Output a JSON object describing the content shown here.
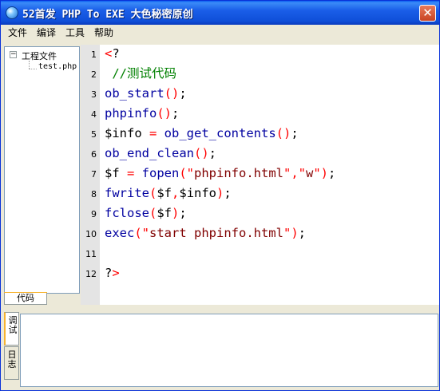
{
  "window": {
    "title": "52首发 PHP To EXE 大色秘密原创",
    "close_symbol": "✕"
  },
  "menu": [
    "文件",
    "编译",
    "工具",
    "帮助"
  ],
  "tree": {
    "expander": "−",
    "root": "工程文件",
    "child": "test.php"
  },
  "tabs": {
    "code": "代码",
    "debug": "调试",
    "log": "日志"
  },
  "line_numbers": [
    "1",
    "2",
    "3",
    "4",
    "5",
    "6",
    "7",
    "8",
    "9",
    "10",
    "11",
    "12"
  ],
  "code": [
    [
      {
        "t": "<",
        "c": "#ff0000"
      },
      {
        "t": "?",
        "c": "#000000"
      }
    ],
    [
      {
        "t": " //测试代码",
        "c": "#008000"
      }
    ],
    [
      {
        "t": "ob_start",
        "c": "#0000a0"
      },
      {
        "t": "()",
        "c": "#ff0000"
      },
      {
        "t": ";",
        "c": "#000000"
      }
    ],
    [
      {
        "t": "phpinfo",
        "c": "#0000a0"
      },
      {
        "t": "()",
        "c": "#ff0000"
      },
      {
        "t": ";",
        "c": "#000000"
      }
    ],
    [
      {
        "t": "$info",
        "c": "#000000"
      },
      {
        "t": " = ",
        "c": "#ff0000"
      },
      {
        "t": "ob_get_contents",
        "c": "#0000a0"
      },
      {
        "t": "()",
        "c": "#ff0000"
      },
      {
        "t": ";",
        "c": "#000000"
      }
    ],
    [
      {
        "t": "ob_end_clean",
        "c": "#0000a0"
      },
      {
        "t": "()",
        "c": "#ff0000"
      },
      {
        "t": ";",
        "c": "#000000"
      }
    ],
    [
      {
        "t": "$f",
        "c": "#000000"
      },
      {
        "t": " = ",
        "c": "#ff0000"
      },
      {
        "t": "fopen",
        "c": "#0000a0"
      },
      {
        "t": "(\"",
        "c": "#ff0000"
      },
      {
        "t": "phpinfo.html",
        "c": "#800000"
      },
      {
        "t": "\",\"",
        "c": "#ff0000"
      },
      {
        "t": "w",
        "c": "#800000"
      },
      {
        "t": "\")",
        "c": "#ff0000"
      },
      {
        "t": ";",
        "c": "#000000"
      }
    ],
    [
      {
        "t": "fwrite",
        "c": "#0000a0"
      },
      {
        "t": "(",
        "c": "#ff0000"
      },
      {
        "t": "$f",
        "c": "#000000"
      },
      {
        "t": ",",
        "c": "#ff0000"
      },
      {
        "t": "$info",
        "c": "#000000"
      },
      {
        "t": ")",
        "c": "#ff0000"
      },
      {
        "t": ";",
        "c": "#000000"
      }
    ],
    [
      {
        "t": "fclose",
        "c": "#0000a0"
      },
      {
        "t": "(",
        "c": "#ff0000"
      },
      {
        "t": "$f",
        "c": "#000000"
      },
      {
        "t": ")",
        "c": "#ff0000"
      },
      {
        "t": ";",
        "c": "#000000"
      }
    ],
    [
      {
        "t": "exec",
        "c": "#0000a0"
      },
      {
        "t": "(\"",
        "c": "#ff0000"
      },
      {
        "t": "start phpinfo.html",
        "c": "#800000"
      },
      {
        "t": "\")",
        "c": "#ff0000"
      },
      {
        "t": ";",
        "c": "#000000"
      }
    ],
    [],
    [
      {
        "t": "?",
        "c": "#000000"
      },
      {
        "t": ">",
        "c": "#ff0000"
      }
    ]
  ]
}
